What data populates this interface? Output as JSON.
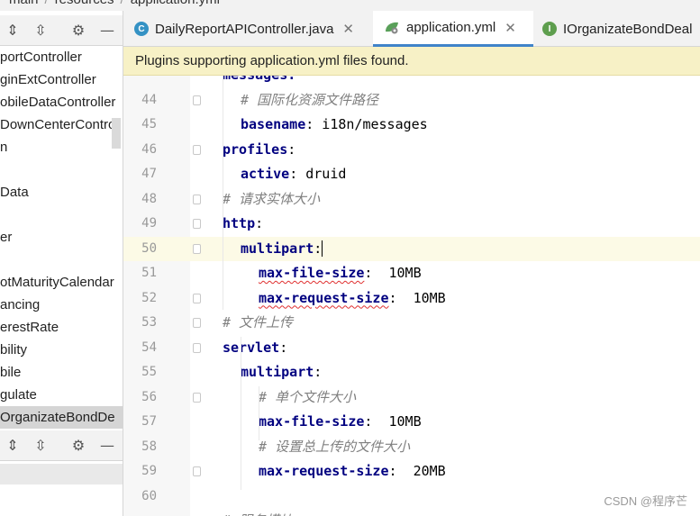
{
  "breadcrumb": {
    "items": [
      "main",
      "resources",
      "application.yml"
    ]
  },
  "project_panel": {
    "items": [
      {
        "label": "portController"
      },
      {
        "label": "ginExtController"
      },
      {
        "label": "obileDataController"
      },
      {
        "label": "DownCenterContro"
      },
      {
        "label": "n"
      },
      {
        "label": ""
      },
      {
        "label": "Data"
      },
      {
        "label": ""
      },
      {
        "label": "er"
      },
      {
        "label": ""
      },
      {
        "label": "otMaturityCalendar"
      },
      {
        "label": "ancing"
      },
      {
        "label": "erestRate"
      },
      {
        "label": "bility"
      },
      {
        "label": "bile"
      },
      {
        "label": "gulate"
      },
      {
        "label": "OrganizateBondDe",
        "selected": true
      }
    ]
  },
  "tabs": [
    {
      "label": "DailyReportAPIController.java",
      "icon": "class-icon",
      "icon_color": "#3592c4",
      "icon_letter": "C",
      "closable": true,
      "active": false
    },
    {
      "label": "application.yml",
      "icon": "yaml-config-icon",
      "icon_color": "#5aa05a",
      "icon_letter": "",
      "closable": true,
      "active": true
    },
    {
      "label": "IOrganizateBondDeal",
      "icon": "interface-icon",
      "icon_color": "#5e9e4e",
      "icon_letter": "I",
      "closable": false,
      "active": false
    }
  ],
  "banner": {
    "text": "Plugins supporting application.yml files found."
  },
  "editor": {
    "current_line": 50,
    "lines": [
      {
        "n": "",
        "indent": 1,
        "parts": [
          {
            "t": "messages:",
            "c": "k"
          }
        ]
      },
      {
        "n": "44",
        "indent": 2,
        "parts": [
          {
            "t": "# 国际化资源文件路径",
            "c": "cm"
          }
        ]
      },
      {
        "n": "45",
        "indent": 2,
        "parts": [
          {
            "t": "basename",
            "c": "k"
          },
          {
            "t": ": i18n/messages",
            "c": "v"
          }
        ]
      },
      {
        "n": "46",
        "indent": 1,
        "parts": [
          {
            "t": "profiles",
            "c": "k"
          },
          {
            "t": ":",
            "c": "v"
          }
        ]
      },
      {
        "n": "47",
        "indent": 2,
        "parts": [
          {
            "t": "active",
            "c": "k"
          },
          {
            "t": ": druid",
            "c": "v"
          }
        ]
      },
      {
        "n": "48",
        "indent": 1,
        "parts": [
          {
            "t": "# 请求实体大小",
            "c": "cm"
          }
        ]
      },
      {
        "n": "49",
        "indent": 1,
        "parts": [
          {
            "t": "http",
            "c": "k"
          },
          {
            "t": ":",
            "c": "v"
          }
        ]
      },
      {
        "n": "50",
        "indent": 2,
        "parts": [
          {
            "t": "multipart",
            "c": "k"
          },
          {
            "t": ":",
            "c": "v"
          }
        ]
      },
      {
        "n": "51",
        "indent": 3,
        "parts": [
          {
            "t": "max-file-size",
            "c": "k warn"
          },
          {
            "t": ":  10MB",
            "c": "v"
          }
        ]
      },
      {
        "n": "52",
        "indent": 3,
        "parts": [
          {
            "t": "max-request-size",
            "c": "k warn"
          },
          {
            "t": ":  10MB",
            "c": "v"
          }
        ]
      },
      {
        "n": "53",
        "indent": 1,
        "parts": [
          {
            "t": "# 文件上传",
            "c": "cm"
          }
        ]
      },
      {
        "n": "54",
        "indent": 1,
        "parts": [
          {
            "t": "servlet",
            "c": "k"
          },
          {
            "t": ":",
            "c": "v"
          }
        ]
      },
      {
        "n": "55",
        "indent": 2,
        "parts": [
          {
            "t": "multipart",
            "c": "k"
          },
          {
            "t": ":",
            "c": "v"
          }
        ]
      },
      {
        "n": "56",
        "indent": 3,
        "parts": [
          {
            "t": "# 单个文件大小",
            "c": "cm"
          }
        ]
      },
      {
        "n": "57",
        "indent": 3,
        "parts": [
          {
            "t": "max-file-size",
            "c": "k"
          },
          {
            "t": ":  10MB",
            "c": "v"
          }
        ]
      },
      {
        "n": "58",
        "indent": 3,
        "parts": [
          {
            "t": "# 设置总上传的文件大小",
            "c": "cm"
          }
        ]
      },
      {
        "n": "59",
        "indent": 3,
        "parts": [
          {
            "t": "max-request-size",
            "c": "k"
          },
          {
            "t": ":  20MB",
            "c": "v"
          }
        ]
      },
      {
        "n": "60",
        "indent": 1,
        "parts": []
      },
      {
        "n": "",
        "indent": 1,
        "parts": [
          {
            "t": "# 服务模块",
            "c": "cm"
          }
        ]
      }
    ]
  },
  "watermark": {
    "text": "CSDN @程序芒"
  }
}
